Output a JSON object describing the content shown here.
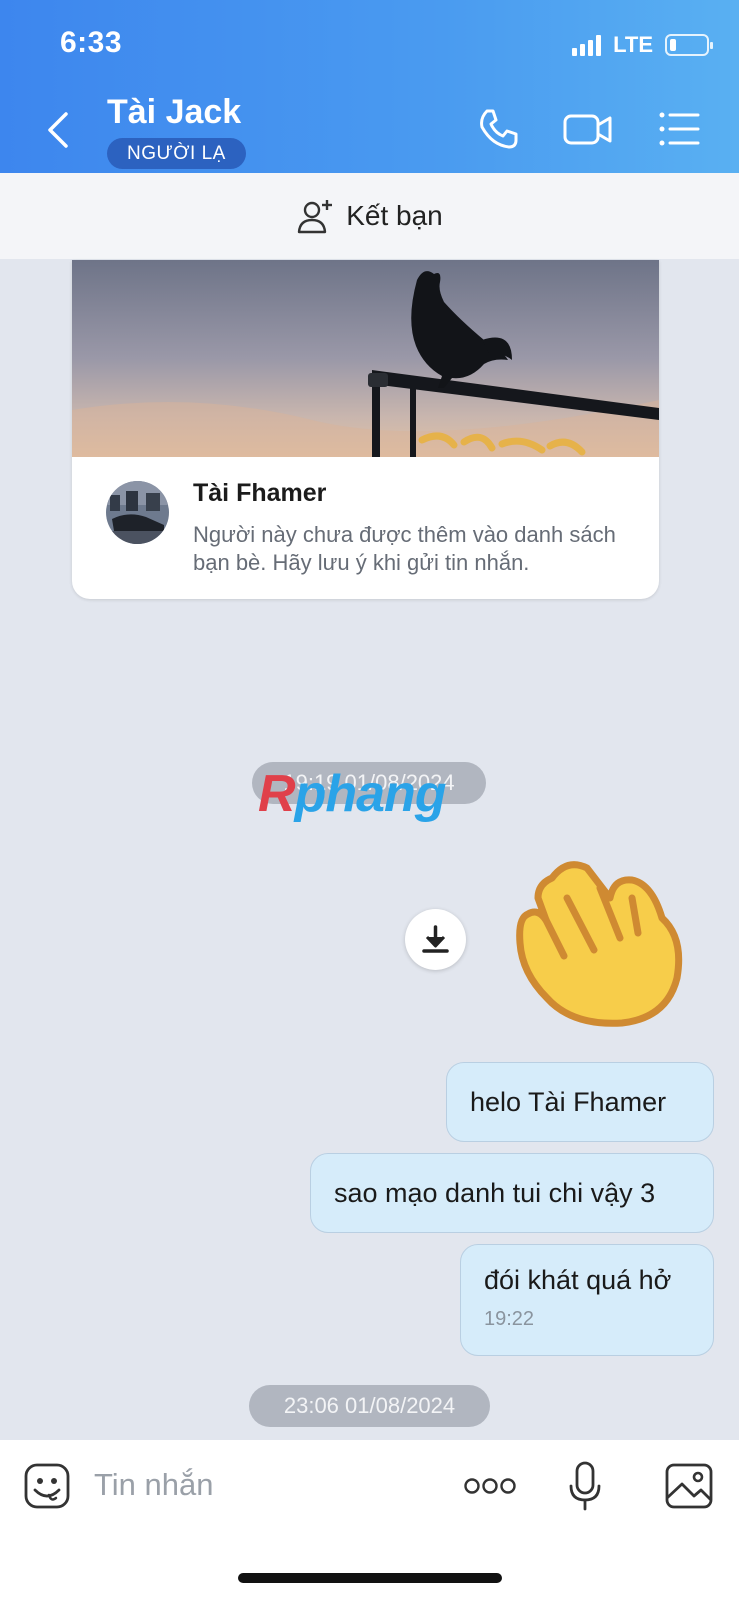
{
  "status_bar": {
    "time": "6:33",
    "network": "LTE",
    "battery_level": 0.18
  },
  "header": {
    "contact_name": "Tài Jack",
    "badge": "NGƯỜI LẠ",
    "icons": [
      "back-icon",
      "phone-icon",
      "video-call-icon",
      "menu-list-icon"
    ]
  },
  "friend_bar": {
    "label": "Kết bạn",
    "icon": "add-person-icon"
  },
  "profile_card": {
    "name": "Tài Fhamer",
    "note": "Người này chưa được thêm vào danh sách bạn bè. Hãy lưu ý khi gửi tin nhắn."
  },
  "messages": {
    "timestamp_1": "19:19 01/08/2024",
    "sticker": "waving-hand",
    "msg_1": "helo Tài Fhamer",
    "msg_2": "sao mạo danh tui chi vậy 3",
    "msg_3": "đói khát quá hở",
    "msg_3_time": "19:22",
    "timestamp_2": "23:06 01/08/2024"
  },
  "watermark": {
    "part1": "R",
    "part2": "phang"
  },
  "input_bar": {
    "placeholder": "Tin nhắn",
    "icons": [
      "emoji-icon",
      "more-icon",
      "microphone-icon",
      "image-icon"
    ]
  },
  "colors": {
    "header_start": "#3d86ee",
    "header_end": "#59b0f2",
    "badge": "#2c62c0",
    "bubble": "#d6ecfa",
    "chat_bg": "#e2e6ee"
  }
}
